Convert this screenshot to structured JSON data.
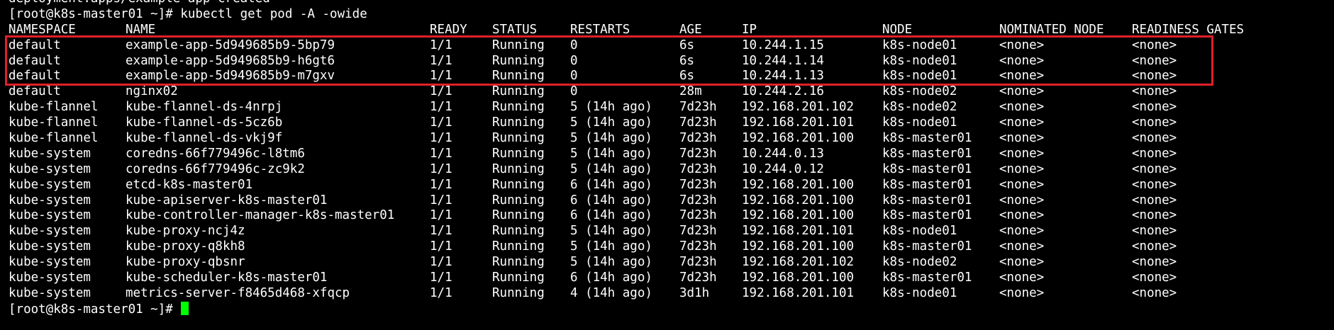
{
  "terminal": {
    "cursor_color": "#00ff00",
    "highlight_color": "#e0202a",
    "previous_output": "deployment.apps/example-app created",
    "prompt": "[root@k8s-master01 ~]#",
    "command": " kubectl get pod -A -owide",
    "table": {
      "headers": [
        "NAMESPACE",
        "NAME",
        "READY",
        "STATUS",
        "RESTARTS",
        "AGE",
        "IP",
        "NODE",
        "NOMINATED NODE",
        "READINESS GATES"
      ],
      "rows": [
        [
          "default",
          "example-app-5d949685b9-5bp79",
          "1/1",
          "Running",
          "0",
          "6s",
          "10.244.1.15",
          "k8s-node01",
          "<none>",
          "<none>"
        ],
        [
          "default",
          "example-app-5d949685b9-h6gt6",
          "1/1",
          "Running",
          "0",
          "6s",
          "10.244.1.14",
          "k8s-node01",
          "<none>",
          "<none>"
        ],
        [
          "default",
          "example-app-5d949685b9-m7gxv",
          "1/1",
          "Running",
          "0",
          "6s",
          "10.244.1.13",
          "k8s-node01",
          "<none>",
          "<none>"
        ],
        [
          "default",
          "nginx02",
          "1/1",
          "Running",
          "0",
          "28m",
          "10.244.2.16",
          "k8s-node02",
          "<none>",
          "<none>"
        ],
        [
          "kube-flannel",
          "kube-flannel-ds-4nrpj",
          "1/1",
          "Running",
          "5 (14h ago)",
          "7d23h",
          "192.168.201.102",
          "k8s-node02",
          "<none>",
          "<none>"
        ],
        [
          "kube-flannel",
          "kube-flannel-ds-5cz6b",
          "1/1",
          "Running",
          "5 (14h ago)",
          "7d23h",
          "192.168.201.101",
          "k8s-node01",
          "<none>",
          "<none>"
        ],
        [
          "kube-flannel",
          "kube-flannel-ds-vkj9f",
          "1/1",
          "Running",
          "5 (14h ago)",
          "7d23h",
          "192.168.201.100",
          "k8s-master01",
          "<none>",
          "<none>"
        ],
        [
          "kube-system",
          "coredns-66f779496c-l8tm6",
          "1/1",
          "Running",
          "5 (14h ago)",
          "7d23h",
          "10.244.0.13",
          "k8s-master01",
          "<none>",
          "<none>"
        ],
        [
          "kube-system",
          "coredns-66f779496c-zc9k2",
          "1/1",
          "Running",
          "5 (14h ago)",
          "7d23h",
          "10.244.0.12",
          "k8s-master01",
          "<none>",
          "<none>"
        ],
        [
          "kube-system",
          "etcd-k8s-master01",
          "1/1",
          "Running",
          "6 (14h ago)",
          "7d23h",
          "192.168.201.100",
          "k8s-master01",
          "<none>",
          "<none>"
        ],
        [
          "kube-system",
          "kube-apiserver-k8s-master01",
          "1/1",
          "Running",
          "6 (14h ago)",
          "7d23h",
          "192.168.201.100",
          "k8s-master01",
          "<none>",
          "<none>"
        ],
        [
          "kube-system",
          "kube-controller-manager-k8s-master01",
          "1/1",
          "Running",
          "6 (14h ago)",
          "7d23h",
          "192.168.201.100",
          "k8s-master01",
          "<none>",
          "<none>"
        ],
        [
          "kube-system",
          "kube-proxy-ncj4z",
          "1/1",
          "Running",
          "5 (14h ago)",
          "7d23h",
          "192.168.201.101",
          "k8s-node01",
          "<none>",
          "<none>"
        ],
        [
          "kube-system",
          "kube-proxy-q8kh8",
          "1/1",
          "Running",
          "5 (14h ago)",
          "7d23h",
          "192.168.201.100",
          "k8s-master01",
          "<none>",
          "<none>"
        ],
        [
          "kube-system",
          "kube-proxy-qbsnr",
          "1/1",
          "Running",
          "5 (14h ago)",
          "7d23h",
          "192.168.201.102",
          "k8s-node02",
          "<none>",
          "<none>"
        ],
        [
          "kube-system",
          "kube-scheduler-k8s-master01",
          "1/1",
          "Running",
          "6 (14h ago)",
          "7d23h",
          "192.168.201.100",
          "k8s-master01",
          "<none>",
          "<none>"
        ],
        [
          "kube-system",
          "metrics-server-f8465d468-xfqcp",
          "1/1",
          "Running",
          "4 (14h ago)",
          "3d1h",
          "192.168.201.101",
          "k8s-node01",
          "<none>",
          "<none>"
        ]
      ]
    }
  }
}
